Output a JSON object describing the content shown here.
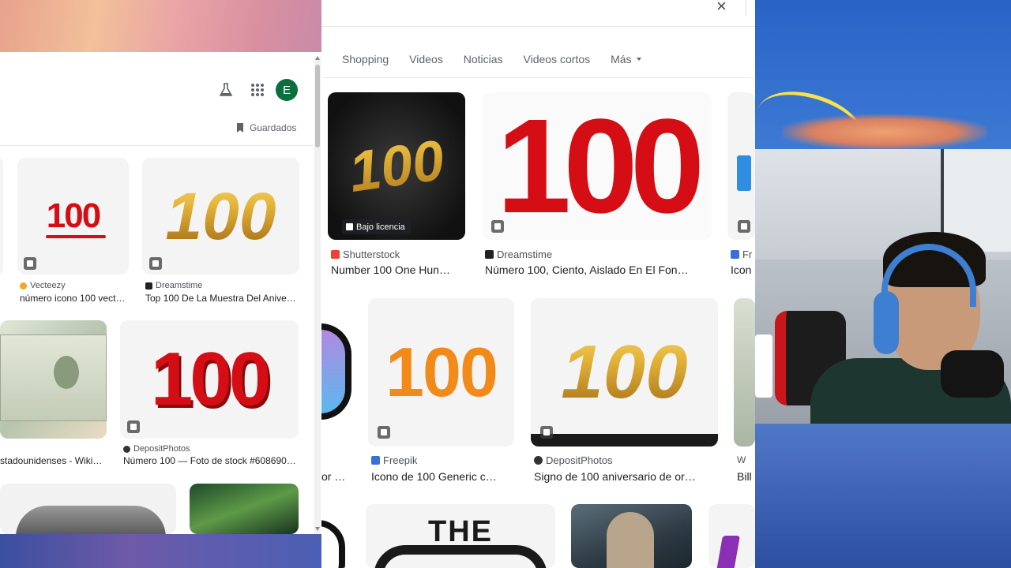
{
  "left_panel": {
    "header": {
      "avatar_letter": "E",
      "saved_label": "Guardados"
    },
    "results": [
      {
        "source": "Vecteezy",
        "source_color": "#f5a623",
        "caption": "número icono 100 vect…",
        "image_text": "100"
      },
      {
        "source": "Dreamstime",
        "source_color": "#222222",
        "caption": "Top 100 De La Muestra Del Anive…",
        "image_text": "100"
      },
      {
        "source": "",
        "caption": "stadounidenses - Wiki…",
        "image_text": ""
      },
      {
        "source": "DepositPhotos",
        "source_color": "#333333",
        "caption": "Número 100 — Foto de stock #608690…",
        "image_text": "100"
      }
    ]
  },
  "main_panel": {
    "tabs": [
      {
        "label": "Shopping"
      },
      {
        "label": "Videos"
      },
      {
        "label": "Noticias"
      },
      {
        "label": "Videos cortos"
      },
      {
        "label": "Más"
      }
    ],
    "results_row1": [
      {
        "source": "Shutterstock",
        "source_color": "#ee4035",
        "caption": "Number 100 One Hun…",
        "image_text": "100",
        "licence_badge": "Bajo licencia"
      },
      {
        "source": "Dreamstime",
        "source_color": "#222222",
        "caption": "Número 100, Ciento, Aislado En El Fon…",
        "image_text": "100"
      },
      {
        "source": "Fr",
        "source_color": "#3c6fd6",
        "caption": "Icon",
        "image_text": ""
      }
    ],
    "results_row2": [
      {
        "source": "",
        "caption": "or …",
        "image_text": ""
      },
      {
        "source": "Freepik",
        "source_color": "#3c6fd6",
        "caption": "Icono de 100 Generic c…",
        "image_text": "100"
      },
      {
        "source": "DepositPhotos",
        "source_color": "#333333",
        "caption": "Signo de 100 aniversario de or…",
        "image_text": "100"
      },
      {
        "source": "W",
        "source_color": "#555555",
        "caption": "Bill",
        "image_text": ""
      }
    ],
    "results_row3": [
      {
        "image_text": "THE"
      },
      {
        "image_text": ""
      }
    ]
  }
}
